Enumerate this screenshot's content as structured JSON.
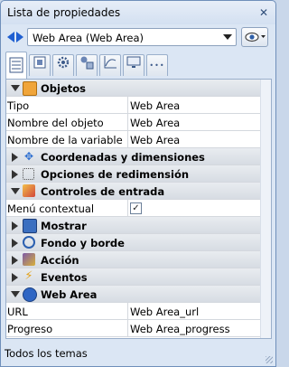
{
  "window": {
    "title": "Lista de propiedades"
  },
  "selector": {
    "value": "Web Area (Web Area)"
  },
  "tabs": [
    {
      "icon": "list-icon",
      "active": true
    },
    {
      "icon": "object-icon"
    },
    {
      "icon": "gear-icon"
    },
    {
      "icon": "shapes-icon"
    },
    {
      "icon": "chart-icon"
    },
    {
      "icon": "monitor-icon"
    },
    {
      "icon": "more-icon",
      "label": "•••"
    }
  ],
  "sections": {
    "objetos": "Objetos",
    "coordenadas": "Coordenadas y dimensiones",
    "redimension": "Opciones de redimensión",
    "controles": "Controles de entrada",
    "mostrar": "Mostrar",
    "fondo": "Fondo y borde",
    "accion": "Acción",
    "eventos": "Eventos",
    "webarea": "Web Area"
  },
  "props": {
    "tipo": {
      "label": "Tipo",
      "value": "Web Area"
    },
    "nombre_objeto": {
      "label": "Nombre del objeto",
      "value": "Web Area"
    },
    "nombre_variable": {
      "label": "Nombre de la variable",
      "value": "Web Area"
    },
    "menu_contextual": {
      "label": "Menú contextual",
      "value": "✓"
    },
    "url": {
      "label": "URL",
      "value": "Web Area_url"
    },
    "progreso": {
      "label": "Progreso",
      "value": "Web Area_progress"
    }
  },
  "status": {
    "text": "Todos los temas"
  },
  "close_glyph": "✕",
  "colors": {
    "accent": "#1f5fd1",
    "section_bg": "#dde1e7"
  }
}
